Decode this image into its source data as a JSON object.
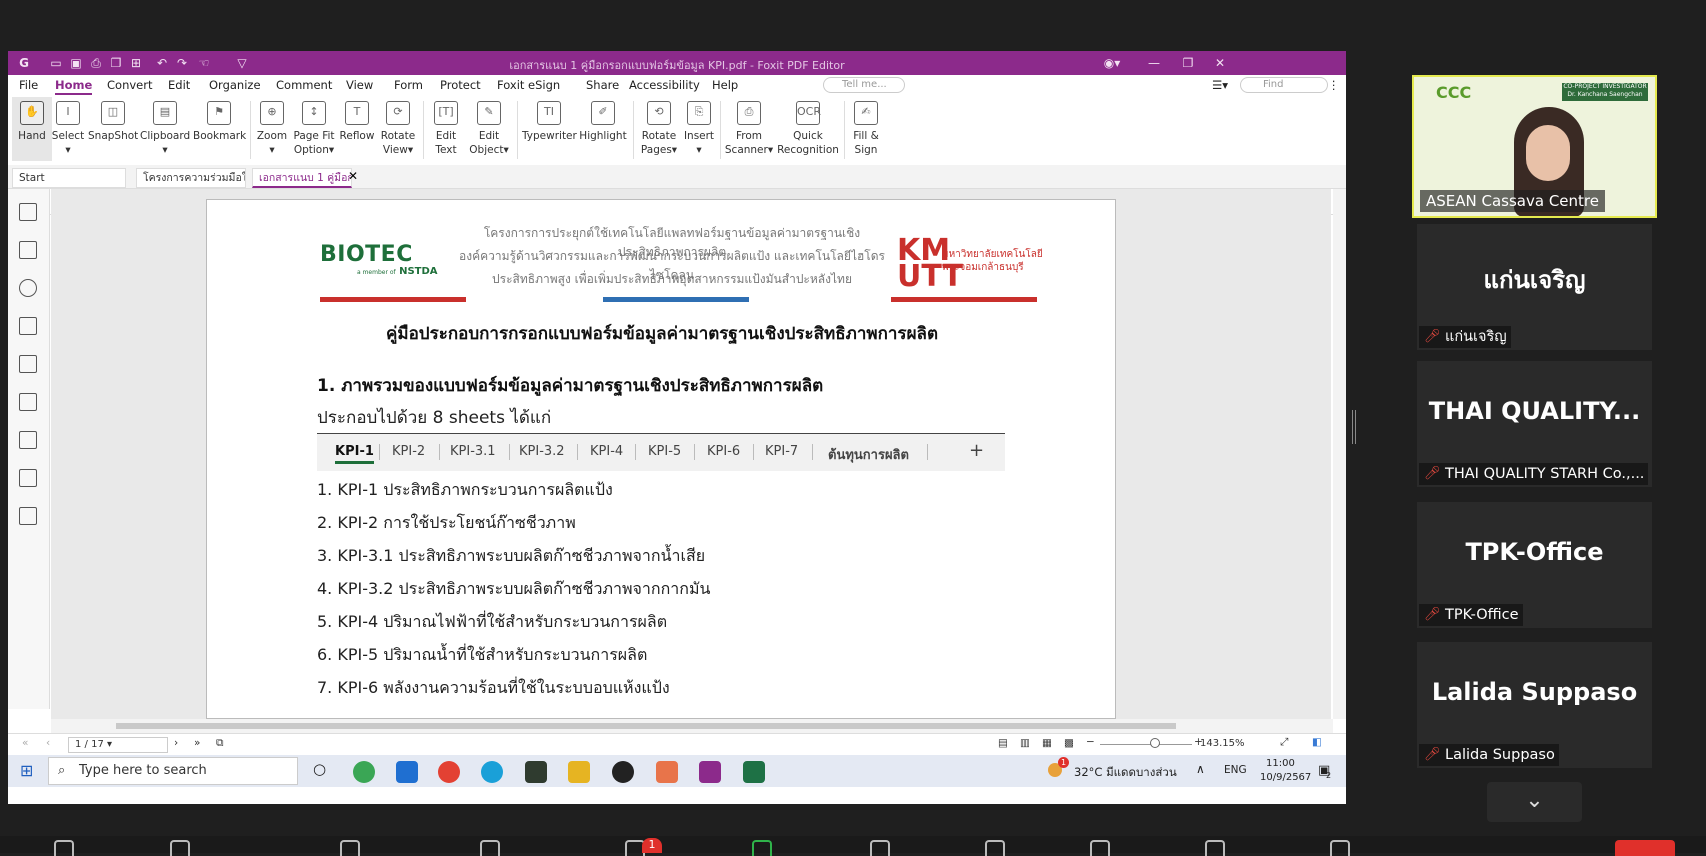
{
  "window": {
    "title": "เอกสารแนบ 1 คู่มือกรอกแบบฟอร์มข้อมูล KPI.pdf - Foxit PDF Editor",
    "accent": "#8c2a8b"
  },
  "menu": {
    "items": [
      "File",
      "Home",
      "Convert",
      "Edit",
      "Organize",
      "Comment",
      "View",
      "Form",
      "Protect",
      "Foxit eSign",
      "Share",
      "Accessibility",
      "Help"
    ],
    "tell_me": "Tell me...",
    "find": "Find"
  },
  "ribbon": {
    "buttons": [
      {
        "l1": "Hand",
        "l2": ""
      },
      {
        "l1": "Select",
        "l2": "▾"
      },
      {
        "l1": "SnapShot",
        "l2": ""
      },
      {
        "l1": "Clipboard",
        "l2": "▾"
      },
      {
        "l1": "Bookmark",
        "l2": ""
      },
      {
        "l1": "Zoom",
        "l2": "▾"
      },
      {
        "l1": "Page Fit",
        "l2": "Option▾"
      },
      {
        "l1": "Reflow",
        "l2": ""
      },
      {
        "l1": "Rotate",
        "l2": "View▾"
      },
      {
        "l1": "Edit",
        "l2": "Text"
      },
      {
        "l1": "Edit",
        "l2": "Object▾"
      },
      {
        "l1": "Typewriter",
        "l2": ""
      },
      {
        "l1": "Highlight",
        "l2": ""
      },
      {
        "l1": "Rotate",
        "l2": "Pages▾"
      },
      {
        "l1": "Insert",
        "l2": "▾"
      },
      {
        "l1": "From",
        "l2": "Scanner▾"
      },
      {
        "l1": "Quick",
        "l2": "Recognition"
      },
      {
        "l1": "Fill &",
        "l2": "Sign"
      }
    ]
  },
  "tabs": [
    "Start",
    "โครงการความร่วมมือในการ...",
    "เอกสารแนบ 1 คู่มือกรอ..."
  ],
  "document": {
    "logo_left": "BIOTEC",
    "logo_left_sub": "NSTDA",
    "logo_left_tag": "a member of",
    "project_lines": [
      "โครงการการประยุกต์ใช้เทคโนโลยีแพลทฟอร์มฐานข้อมูลค่ามาตรฐานเชิงประสิทธิภาพการผลิต",
      "องค์ความรู้ด้านวิศวกรรมและการพัฒนากระบวนการผลิตแป้ง และเทคโนโลยีไฮโดรไซโคลน",
      "ประสิทธิภาพสูง เพื่อเพิ่มประสิทธิภาพอุตสาหกรรมแป้งมันสำปะหลังไทย"
    ],
    "logo_right": "KMUTT",
    "logo_right_text": [
      "มหาวิทยาลัยเทคโนโลยี",
      "พระจอมเกล้าธนบุรี"
    ],
    "bar_colors": [
      "#c9302c",
      "#2f6fb3",
      "#c9302c"
    ],
    "title": "คู่มือประกอบการกรอกแบบฟอร์มข้อมูลค่ามาตรฐานเชิงประสิทธิภาพการผลิต",
    "section_title": "1. ภาพรวมของแบบฟอร์มข้อมูลค่ามาตรฐานเชิงประสิทธิภาพการผลิต",
    "section_sub": "ประกอบไปด้วย 8 sheets ได้แก่",
    "sheet_tabs": [
      "KPI-1",
      "KPI-2",
      "KPI-3.1",
      "KPI-3.2",
      "KPI-4",
      "KPI-5",
      "KPI-6",
      "KPI-7",
      "ต้นทุนการผลิต",
      "+"
    ],
    "kpi_list": [
      "1. KPI-1 ประสิทธิภาพกระบวนการผลิตแป้ง",
      "2. KPI-2 การใช้ประโยชน์ก๊าซชีวภาพ",
      "3. KPI-3.1 ประสิทธิภาพระบบผลิตก๊าซชีวภาพจากน้ำเสีย",
      "4. KPI-3.2 ประสิทธิภาพระบบผลิตก๊าซชีวภาพจากกากมัน",
      "5. KPI-4 ปริมาณไฟฟ้าที่ใช้สำหรับกระบวนการผลิต",
      "6. KPI-5 ปริมาณน้ำที่ใช้สำหรับกระบวนการผลิต",
      "7. KPI-6 พลังงานความร้อนที่ใช้ในระบบอบแห้งแป้ง"
    ]
  },
  "status": {
    "page": "1 / 17",
    "zoom": "143.15%"
  },
  "taskbar": {
    "search_placeholder": "Type here to search",
    "weather": "32°C  มีแดดบางส่วน",
    "lang": "ENG",
    "time": "11:00",
    "date": "10/9/2567",
    "weather_badge": "1",
    "notif_count": "2"
  },
  "meeting": {
    "active_speaker": "ASEAN Cassava Centre",
    "video_logo": "CCC",
    "video_banner": "CO-PROJECT INVESTIGATOR Dr. Kanchana Saengchan",
    "participants": [
      {
        "big": "แก่นเจริญ",
        "label": "แก่นเจริญ"
      },
      {
        "big": "THAI  QUALITY...",
        "label": "THAI QUALITY STARH Co.,..."
      },
      {
        "big": "TPK-Office",
        "label": "TPK-Office"
      },
      {
        "big": "Lalida Suppaso",
        "label": "Lalida Suppaso"
      }
    ],
    "chat_badge": "1"
  }
}
